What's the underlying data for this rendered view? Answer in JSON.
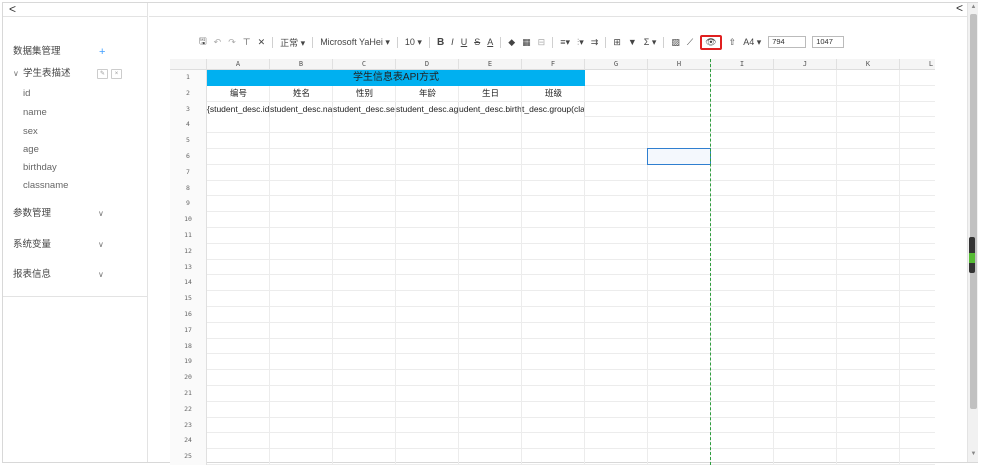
{
  "nav": {
    "back_glyph": "<",
    "right_back_glyph": "<"
  },
  "sidebar": {
    "dataset": {
      "label": "数据集管理",
      "add": "+"
    },
    "table": {
      "label": "学生表描述",
      "caret": "∨"
    },
    "fields": [
      "id",
      "name",
      "sex",
      "age",
      "birthday",
      "classname"
    ],
    "groups": [
      {
        "label": "参数管理",
        "caret": "∨"
      },
      {
        "label": "系统变量",
        "caret": "∨"
      },
      {
        "label": "报表信息",
        "caret": "∨"
      }
    ]
  },
  "toolbar": {
    "save": "🖫",
    "undo": "↶",
    "redo": "↷",
    "format_painter": "⊤",
    "clear_format": "✕",
    "number_format": "正常 ▾",
    "font_family": "Microsoft YaHei ▾",
    "font_size": "10 ▾",
    "bold": "B",
    "italic": "I",
    "underline": "U",
    "strikethrough": "S",
    "font_color": "A",
    "fill_color": "◆",
    "borders": "▦",
    "merge": "⊟",
    "align_h": "≡▾",
    "align_v": "⫶▾",
    "wrap": "⇉",
    "freeze": "⊞",
    "filter": "▼",
    "functions": "Σ ▾",
    "image": "▨",
    "chart": "⟋",
    "preview": "👁",
    "print_upload": "⇧",
    "paper_size": "A4 ▾",
    "width_value": "794",
    "height_value": "1047"
  },
  "columns": [
    "A",
    "B",
    "C",
    "D",
    "E",
    "F",
    "G",
    "H",
    "I",
    "J",
    "K",
    "L"
  ],
  "rows": [
    "1",
    "2",
    "3",
    "4",
    "5",
    "6",
    "7",
    "8",
    "9",
    "10",
    "11",
    "12",
    "13",
    "14",
    "15",
    "16",
    "17",
    "18",
    "19",
    "20",
    "21",
    "22",
    "23",
    "24",
    "25"
  ],
  "sheet": {
    "title": "学生信息表API方式",
    "headers": [
      "编号",
      "姓名",
      "性别",
      "年龄",
      "生日",
      "班级"
    ],
    "bindings": [
      "{student_desc.id",
      "student_desc.nar",
      "student_desc.se",
      "student_desc.ag",
      "udent_desc.birth",
      "t_desc.group(cla"
    ]
  },
  "colors": {
    "title_fill": "#00b0f0",
    "selection": "#2f7fd0",
    "page_break": "#2e9e3e",
    "highlight": "#e02020",
    "accent": "#409eff"
  }
}
